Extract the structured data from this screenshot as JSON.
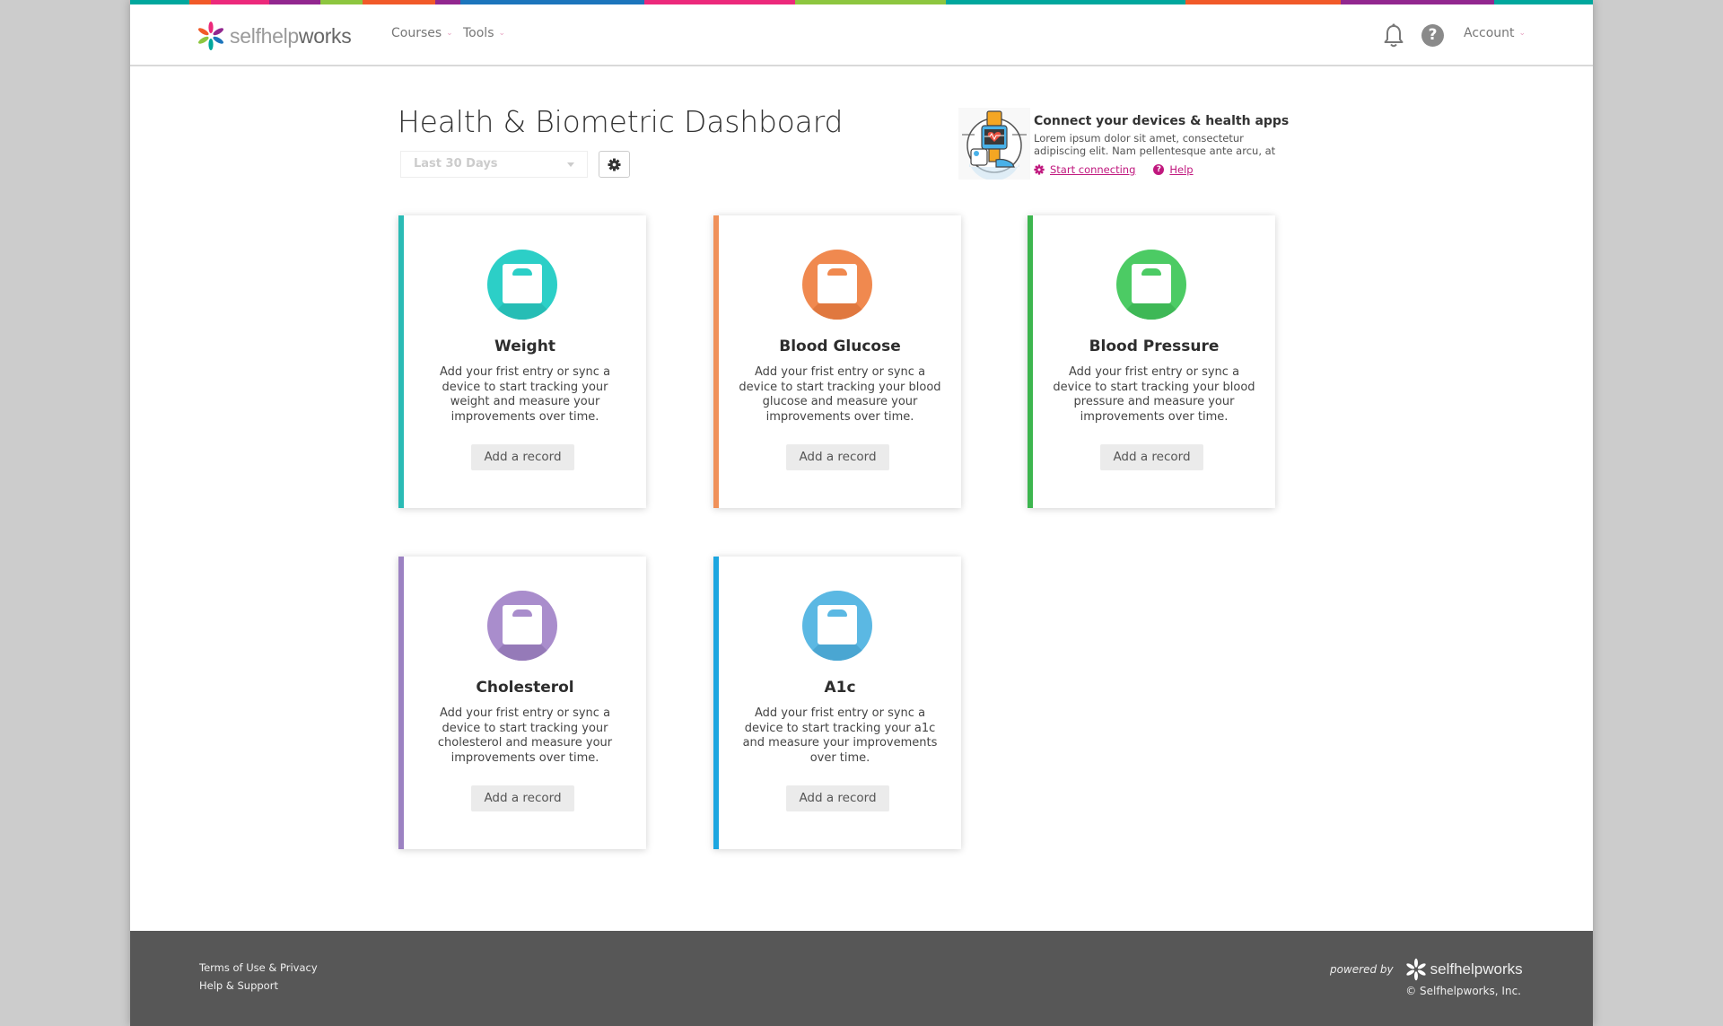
{
  "brand": {
    "name_light": "selfhelp",
    "name_bold": "works",
    "stripe_colors": [
      "#00a79d",
      "#f15a29",
      "#ec297b",
      "#92278f",
      "#8dc63f",
      "#f15a29",
      "#92278f",
      "#1c75bc",
      "#ec297b",
      "#8dc63f",
      "#00a79d",
      "#f15a29",
      "#92278f",
      "#00a79d"
    ]
  },
  "nav": {
    "courses": "Courses",
    "tools": "Tools",
    "account": "Account",
    "help_glyph": "?"
  },
  "dashboard": {
    "title": "Health & Biometric Dashboard",
    "range_select": "Last 30 Days"
  },
  "connect": {
    "title": "Connect your devices & health apps",
    "description": "Lorem ipsum dolor sit amet, consectetur adipiscing elit. Nam pellentesque ante arcu, at",
    "start_link": "Start connecting",
    "help_link": "Help",
    "accent": "#c0187e"
  },
  "cards": [
    {
      "title": "Weight",
      "description": "Add your frist entry or sync a device to start tracking your weight and measure your improvements over time.",
      "button": "Add a record",
      "color": "#2ccfc7",
      "border": "#2bbbb5",
      "shade": "#26bdb5"
    },
    {
      "title": "Blood Glucose",
      "description": "Add your frist entry or sync a device to start tracking your blood glucose and measure your improvements over time.",
      "button": "Add a record",
      "color": "#f0894f",
      "border": "#f0915a",
      "shade": "#e0783f"
    },
    {
      "title": "Blood Pressure",
      "description": "Add your frist entry or sync a device to start tracking your blood pressure and measure your improvements over time.",
      "button": "Add a record",
      "color": "#4ccb64",
      "border": "#3db64f",
      "shade": "#3eb856"
    },
    {
      "title": "Cholesterol",
      "description": "Add your frist entry or sync a device to start tracking your cholesterol and measure your improvements over time.",
      "button": "Add a record",
      "color": "#a98dcc",
      "border": "#9c82c2",
      "shade": "#957ab8"
    },
    {
      "title": "A1c",
      "description": "Add your frist entry or sync a device to start tracking your a1c and measure your improvements over time.",
      "button": "Add a record",
      "color": "#5bb8e3",
      "border": "#1ca6e0",
      "shade": "#4aa6d2"
    }
  ],
  "footer": {
    "terms": "Terms of Use & Privacy",
    "support": "Help & Support",
    "powered_by": "powered by",
    "brand": "selfhelpworks",
    "copyright": "© Selfhelpworks, Inc."
  }
}
